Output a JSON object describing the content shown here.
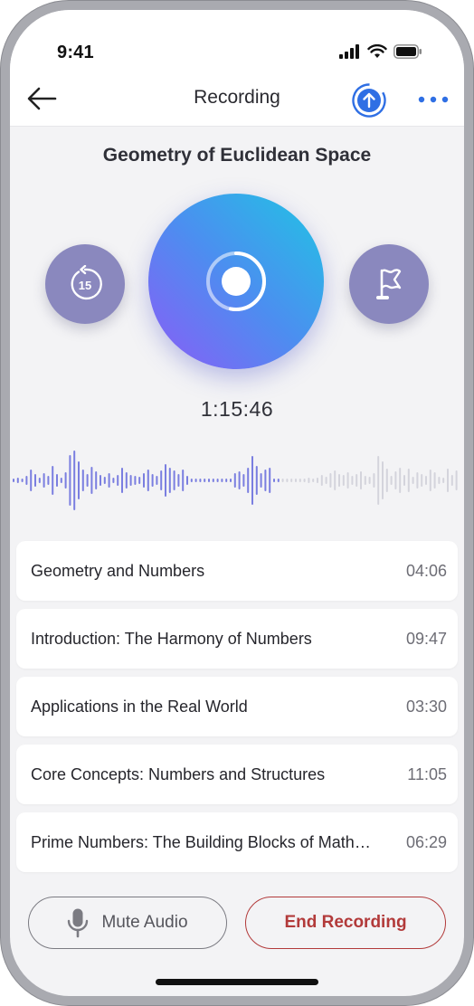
{
  "status_bar": {
    "time": "9:41"
  },
  "nav": {
    "title": "Recording",
    "back_icon": "arrow-left-icon",
    "upload_icon": "upload-circle-icon",
    "more_icon": "ellipsis-icon"
  },
  "recording": {
    "title": "Geometry of Euclidean Space",
    "timer": "1:15:46",
    "rewind_label": "15",
    "progress_fraction": 0.53
  },
  "sections": [
    {
      "name": "Geometry and Numbers",
      "duration": "04:06"
    },
    {
      "name": "Introduction: The Harmony of Numbers",
      "duration": "09:47"
    },
    {
      "name": "Applications in the Real World",
      "duration": "03:30"
    },
    {
      "name": "Core Concepts: Numbers and Structures",
      "duration": "11:05"
    },
    {
      "name": "Prime Numbers: The Building Blocks of Mathematics",
      "duration": "06:29"
    }
  ],
  "actions": {
    "mute_label": "Mute Audio",
    "end_label": "End Recording"
  },
  "colors": {
    "accent": "#2f6fe4",
    "side_button": "#8a88be",
    "wave_active": "#7a7ee0",
    "wave_inactive": "#d4d4dc",
    "danger": "#b23a3a"
  }
}
